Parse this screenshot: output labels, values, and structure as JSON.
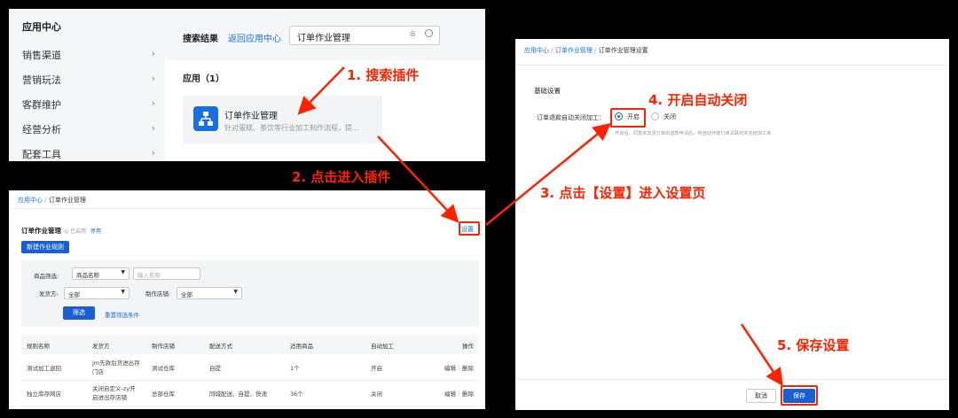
{
  "panel1": {
    "sidebar_title": "应用中心",
    "sidebar_items": [
      "销售渠道",
      "营销玩法",
      "客群维护",
      "经营分析",
      "配套工具"
    ],
    "search_results_label": "搜索结果",
    "back_link": "返回应用中心",
    "search_value": "订单作业管理",
    "apps_label": "应用（1）",
    "app_name": "订单作业管理",
    "app_desc": "针对蛋糕、茶饮等行业加工制作流程，提..."
  },
  "panel2": {
    "breadcrumb_root": "应用中心",
    "breadcrumb_sep": "/",
    "breadcrumb_current": "订单作业管理",
    "title": "订单作业管理",
    "status": "◎ 已启用",
    "disable_link": "停用",
    "settings_link": "设置",
    "new_rule_button": "新建作业规则",
    "filter_product_label": "商品筛选:",
    "filter_product_select": "商品名称",
    "filter_product_placeholder": "输入名称",
    "filter_ship_label": "发货方:",
    "filter_ship_select": "全部",
    "filter_store_label": "制作店铺:",
    "filter_store_select": "全部",
    "filter_button": "筛选",
    "reset_link": "重置筛选条件",
    "columns": [
      "规则名称",
      "发货方",
      "制作店铺",
      "配送方式",
      "适用商品",
      "自动加工",
      "操作"
    ],
    "rows": [
      {
        "name": "测试加工退回",
        "ship_line1": "jm先款后货进出存",
        "ship_line2": "门店",
        "store": "测试仓库",
        "delivery": "自提",
        "goods": "1个",
        "auto": "开启",
        "edit": "编辑",
        "sep": "|",
        "del": "删除"
      },
      {
        "name": "独立库存网店",
        "ship_line1": "关闭自定义-zy开",
        "ship_line2": "启进出存店铺",
        "store": "总部仓库",
        "delivery": "同城配送、自提、快递",
        "goods": "36个",
        "auto": "关闭",
        "edit": "编辑",
        "sep": "|",
        "del": "删除"
      }
    ]
  },
  "panel3": {
    "breadcrumb": [
      "应用中心",
      "订单作业管理",
      "订单作业管理设置"
    ],
    "breadcrumb_sep": "/",
    "section_title": "基础设置",
    "setting_label": "订单退款自动关闭加工：",
    "option_on": "开启",
    "option_off": "关闭",
    "hint": "开启后，同意未发货订单的退款申请后，将自动作废订单关联的未完结加工单",
    "cancel_button": "取消",
    "save_button": "保存"
  },
  "annotations": {
    "step1": "1. 搜索插件",
    "step2": "2. 点击进入插件",
    "step3": "3. 点击【设置】进入设置页",
    "step4": "4. 开启自动关闭",
    "step5": "5. 保存设置"
  },
  "colors": {
    "accent": "#1a5fd1",
    "annotation": "#ff2200",
    "background": "#000000"
  }
}
